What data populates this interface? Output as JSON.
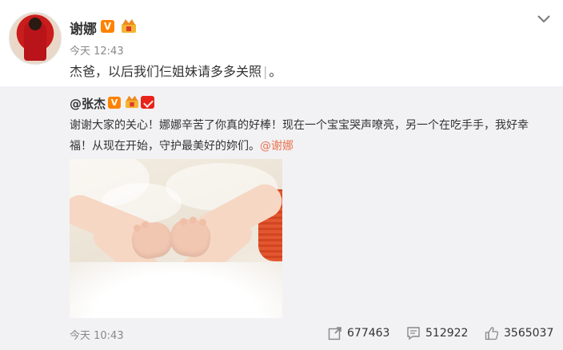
{
  "post": {
    "author": "谢娜",
    "time": "今天 12:43",
    "text": "杰爸，以后我们仨姐妹请多多关照",
    "text_end": "。"
  },
  "repost": {
    "author": "@张杰",
    "text_line1": "谢谢大家的关心！娜娜辛苦了你真的好棒！现在一个宝宝哭声嘹亮，另一个在吃手手，我好幸",
    "text_line2": "福！从现在开始，守护最美好的妳们。",
    "mention": "@谢娜",
    "time": "今天 10:43",
    "forward_count": "677463",
    "comment_count": "512922",
    "like_count": "3565037"
  },
  "icons": {
    "verified": "V",
    "options": "chevron-down-icon",
    "forward": "share-icon",
    "comment": "comment-icon",
    "like": "thumbs-up-icon"
  },
  "colors": {
    "verified_badge": "#ff8200",
    "mention": "#eb7350",
    "repost_bg": "#f2f2f5"
  }
}
